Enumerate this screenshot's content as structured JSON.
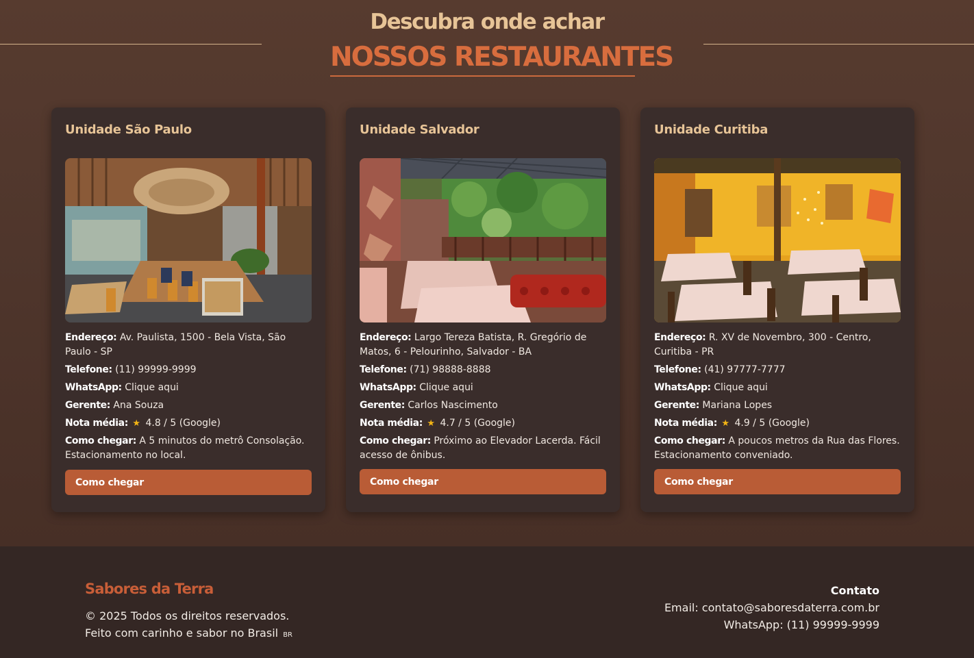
{
  "header": {
    "subtitle": "Descubra onde achar",
    "title": "NOSSOS RESTAURANTES"
  },
  "labels": {
    "address": "Endereço:",
    "phone": "Telefone:",
    "whatsapp": "WhatsApp:",
    "manager": "Gerente:",
    "rating": "Nota média:",
    "directions": "Como chegar:",
    "star": "★"
  },
  "units": [
    {
      "name": "Unidade São Paulo",
      "photo_alt": "Salão interno com mesas de madeira",
      "address": "Av. Paulista, 1500 - Bela Vista, São Paulo - SP",
      "phone": "(11) 99999-9999",
      "whatsapp": "Clique aqui",
      "manager": "Ana Souza",
      "rating": "4.8 / 5 (Google)",
      "directions": "A 5 minutos do metrô Consolação. Estacionamento no local.",
      "button": "Como chegar"
    },
    {
      "name": "Unidade Salvador",
      "photo_alt": "Varanda com sofás vermelhos e vegetação",
      "address": "Largo Tereza Batista, R. Gregório de Matos, 6 - Pelourinho, Salvador - BA",
      "phone": "(71) 98888-8888",
      "whatsapp": "Clique aqui",
      "manager": "Carlos Nascimento",
      "rating": "4.7 / 5 (Google)",
      "directions": "Próximo ao Elevador Lacerda. Fácil acesso de ônibus.",
      "button": "Como chegar"
    },
    {
      "name": "Unidade Curitiba",
      "photo_alt": "Salão amarelo com mesas e cadeiras de madeira",
      "address": "R. XV de Novembro, 300 - Centro, Curitiba - PR",
      "phone": "(41) 97777-7777",
      "whatsapp": "Clique aqui",
      "manager": "Mariana Lopes",
      "rating": "4.9 / 5 (Google)",
      "directions": "A poucos metros da Rua das Flores. Estacionamento conveniado.",
      "button": "Como chegar"
    }
  ],
  "footer": {
    "brand": "Sabores da Terra",
    "copyright": "© 2025 Todos os direitos reservados.",
    "made_with": "Feito com carinho e sabor no Brasil",
    "flag": "BR",
    "contact_title": "Contato",
    "email": "Email: contato@saboresdaterra.com.br",
    "whatsapp": "WhatsApp: (11) 99999-9999"
  },
  "colors": {
    "accent": "#d86d3e",
    "gold": "#e7c497",
    "button": "#b95c36",
    "card": "#3a2d2b",
    "footer": "#342724"
  }
}
